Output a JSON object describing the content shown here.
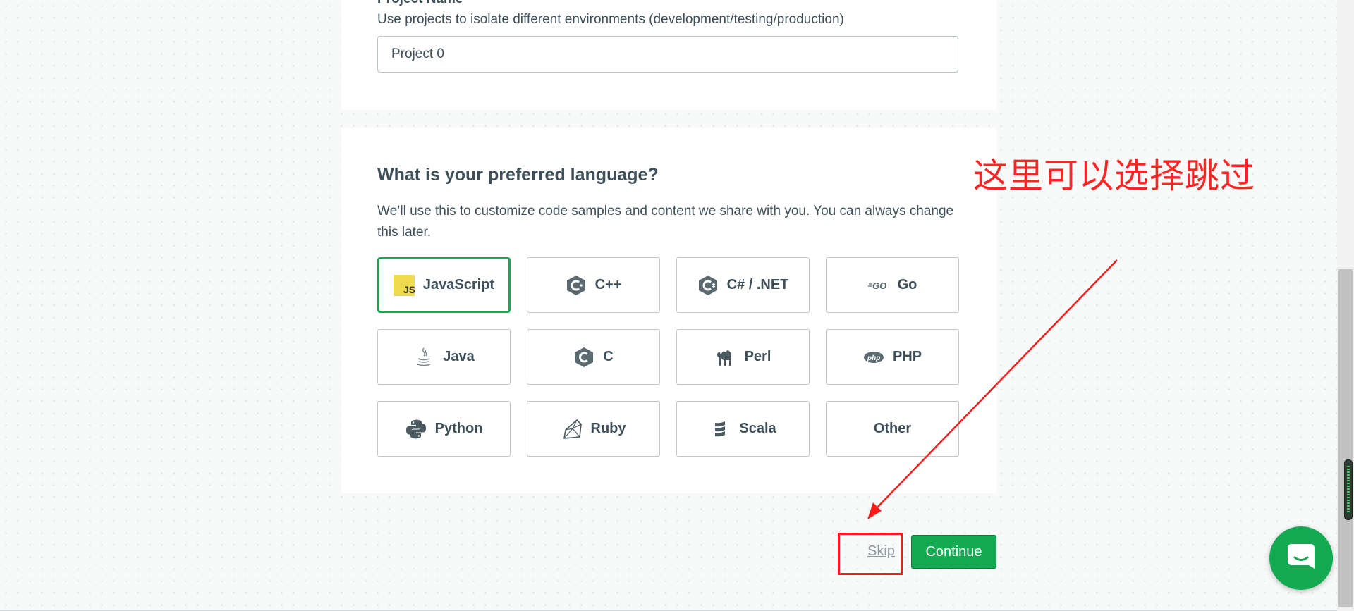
{
  "project": {
    "section_label": "Project Name",
    "helper_text": "Use projects to isolate different environments (development/testing/production)",
    "input_value": "Project 0"
  },
  "language": {
    "title": "What is your preferred language?",
    "description": "We’ll use this to customize code samples and content we share with you. You can always change this later.",
    "selected": "JavaScript",
    "accent_color": "#13aa52",
    "options": [
      {
        "label": "JavaScript",
        "icon": "js-icon"
      },
      {
        "label": "C++",
        "icon": "cplusplus-icon"
      },
      {
        "label": "C# / .NET",
        "icon": "csharp-icon"
      },
      {
        "label": "Go",
        "icon": "go-icon"
      },
      {
        "label": "Java",
        "icon": "java-icon"
      },
      {
        "label": "C",
        "icon": "c-icon"
      },
      {
        "label": "Perl",
        "icon": "perl-camel-icon"
      },
      {
        "label": "PHP",
        "icon": "php-icon"
      },
      {
        "label": "Python",
        "icon": "python-icon"
      },
      {
        "label": "Ruby",
        "icon": "ruby-gem-icon"
      },
      {
        "label": "Scala",
        "icon": "scala-icon"
      },
      {
        "label": "Other",
        "icon": ""
      }
    ]
  },
  "actions": {
    "skip_label": "Skip",
    "continue_label": "Continue",
    "continue_color": "#13aa52"
  },
  "annotation": {
    "text": "这里可以选择跳过",
    "color": "#ff2424"
  },
  "chat": {
    "icon": "chat-bubble-icon"
  }
}
